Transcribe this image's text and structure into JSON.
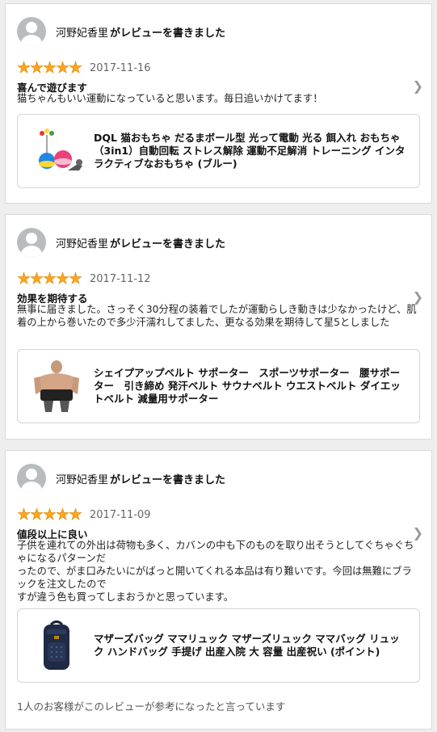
{
  "reviews": [
    {
      "author": "河野妃香里",
      "action": "がレビューを書きました",
      "rating": 5,
      "date": "2017-11-16",
      "title": "喜んで遊びます",
      "body": "猫ちゃんもいい運動になっていると思います。毎日追いかけてます！",
      "product": "DQL 猫おもちゃ だるまボール型 光って電動 光る 餌入れ おもちゃ（3in1）自動回転 ストレス解除 運動不足解消 トレーニング インタラクティブなおもちゃ (ブルー)",
      "product_icon": "cat-toy-icon"
    },
    {
      "author": "河野妃香里",
      "action": "がレビューを書きました",
      "rating": 5,
      "date": "2017-11-12",
      "title": "効果を期待する",
      "body": "無事に届きました。さっそく30分程の装着でしたが運動らしき動きは少なかったけど、肌着の上から巻いたので多少汗濡れしてました、更なる効果を期待して星5としました",
      "product": "シェイプアップベルト サポーター　スポーツサポーター　腰サポーター　引き締め 発汗ベルト サウナベルト ウエストベルト ダイエットベルト 減量用サポーター",
      "product_icon": "waist-belt-icon"
    },
    {
      "author": "河野妃香里",
      "action": "がレビューを書きました",
      "rating": 5,
      "date": "2017-11-09",
      "title": "値段以上に良い",
      "body": "子供を連れての外出は荷物も多く、カバンの中も下のものを取り出そうとしてぐちゃぐちゃになるパターンだ\nったので、がま口みたいにがばっと開いてくれる本品は有り難いです。今回は無難にブラックを注文したので\nすが違う色も買ってしまおうかと思っています。",
      "product": "マザーズバッグ ママリュック マザーズリュック ママバッグ リュック ハンドバッグ 手提げ 出産入院 大 容量 出産祝い (ポイント)",
      "product_icon": "backpack-icon",
      "helpful": "1人のお客様がこのレビューが参考になったと言っています"
    }
  ]
}
